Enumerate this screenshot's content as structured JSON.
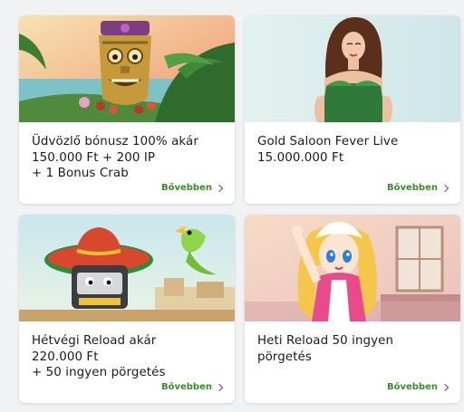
{
  "cards": [
    {
      "title_lines": [
        "Üdvözlő bónusz 100% akár",
        "150.000 Ft + 200 IP",
        "+ 1 Bonus Crab"
      ],
      "more_label": "Bővebben",
      "image": "tiki-mask-slot-artwork"
    },
    {
      "title_lines": [
        "Gold Saloon Fever Live",
        "15.000.000 Ft"
      ],
      "more_label": "Bővebben",
      "image": "live-dealer-woman-green-dress"
    },
    {
      "title_lines": [
        "Hétvégi Reload akár",
        "220.000 Ft",
        "+ 50 ingyen pörgetés"
      ],
      "more_label": "Bővebben",
      "image": "sombrero-slot-machine-parrot"
    },
    {
      "title_lines": [
        "Heti Reload 50 ingyen",
        "pörgetés"
      ],
      "more_label": "Bővebben",
      "image": "anime-maid-girl-cafe"
    }
  ],
  "colors": {
    "accent": "#3a8b2c",
    "background": "#f1f2f4",
    "card": "#ffffff"
  }
}
